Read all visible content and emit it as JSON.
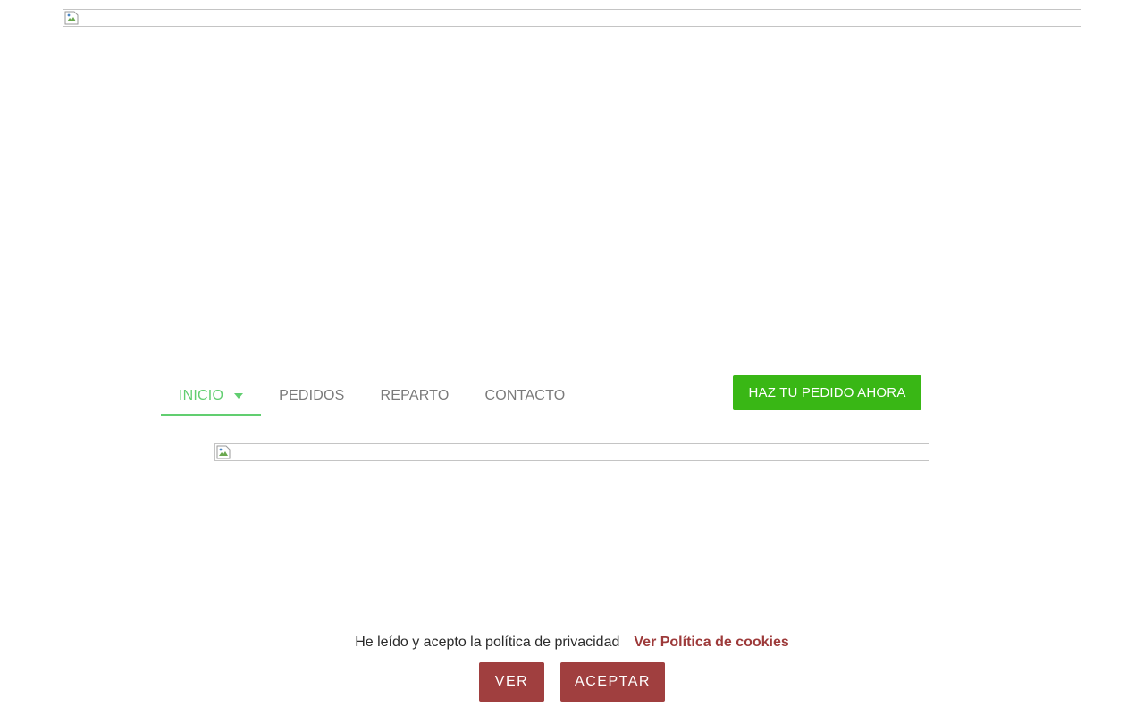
{
  "nav": {
    "items": [
      {
        "label": "INICIO",
        "active": true,
        "has_dropdown": true
      },
      {
        "label": "PEDIDOS",
        "active": false
      },
      {
        "label": "REPARTO",
        "active": false
      },
      {
        "label": "CONTACTO",
        "active": false
      }
    ],
    "active_color": "#61ce70",
    "inactive_color": "#7a7a7a"
  },
  "cta": {
    "label": "HAZ TU PEDIDO AHORA",
    "color": "#39b715"
  },
  "cookie": {
    "text": "He leído y acepto la política de privacidad",
    "link_label": "Ver Política de cookies",
    "buttons": {
      "ver": "VER",
      "aceptar": "ACEPTAR"
    },
    "accent_color": "#a03f3f"
  },
  "images": {
    "hero": {
      "icon": "broken-image-icon"
    },
    "content": {
      "icon": "broken-image-icon"
    }
  }
}
